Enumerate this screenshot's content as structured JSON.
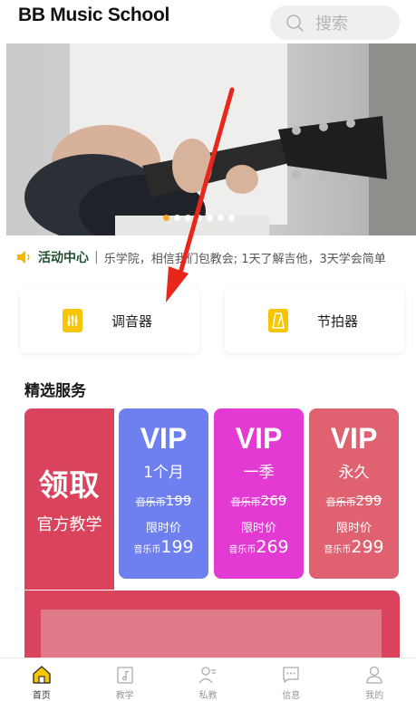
{
  "header": {
    "title": "BB Music School",
    "search_placeholder": "搜索"
  },
  "banner": {
    "slide_count": 7,
    "active_index": 0
  },
  "notice": {
    "title": "活动中心",
    "separator": "|",
    "text": "乐学院，相信我们包教会; 1天了解吉他，3天学会简单"
  },
  "tools": [
    {
      "label": "调音器",
      "icon": "tuner-icon"
    },
    {
      "label": "节拍器",
      "icon": "metronome-icon"
    }
  ],
  "section": {
    "title": "精选服务"
  },
  "promo": {
    "big": "领取",
    "sub": "官方教学"
  },
  "vip_cards": [
    {
      "title": "VIP",
      "period": "1个月",
      "orig_prefix": "音乐币",
      "orig_price": "199",
      "limit": "限时价",
      "price_prefix": "音乐币",
      "price": "199",
      "color": "#6e7ff0"
    },
    {
      "title": "VIP",
      "period": "一季",
      "orig_prefix": "音乐币",
      "orig_price": "269",
      "limit": "限时价",
      "price_prefix": "音乐币",
      "price": "269",
      "color": "#e33ad4"
    },
    {
      "title": "VIP",
      "period": "永久",
      "orig_prefix": "音乐币",
      "orig_price": "299",
      "limit": "限时价",
      "price_prefix": "音乐币",
      "price": "299",
      "color": "#e0616f"
    }
  ],
  "tabbar": {
    "items": [
      {
        "label": "首页",
        "icon": "home-icon",
        "active": true
      },
      {
        "label": "教学",
        "icon": "teaching-icon",
        "active": false
      },
      {
        "label": "私教",
        "icon": "private-tutor-icon",
        "active": false
      },
      {
        "label": "信息",
        "icon": "message-icon",
        "active": false
      },
      {
        "label": "我的",
        "icon": "profile-icon",
        "active": false
      }
    ]
  },
  "colors": {
    "accent_yellow": "#f7c600",
    "promo_red": "#d9445c",
    "annotation_arrow": "#e8261c"
  }
}
